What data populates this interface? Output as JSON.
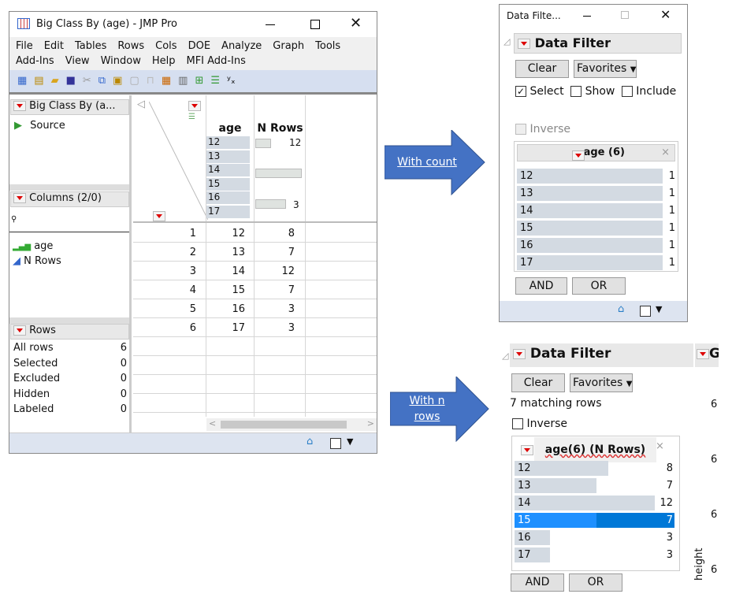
{
  "main_window": {
    "title": "Big Class By (age) - JMP Pro",
    "menu_row1": [
      "File",
      "Edit",
      "Tables",
      "Rows",
      "Cols",
      "DOE",
      "Analyze",
      "Graph",
      "Tools"
    ],
    "menu_row2": [
      "Add-Ins",
      "View",
      "Window",
      "Help",
      "MFI Add-Ins"
    ],
    "table_panel_title": "Big Class By (a...",
    "source_label": "Source",
    "columns_title": "Columns (2/0)",
    "columns": [
      "age",
      "N Rows"
    ],
    "rows_title": "Rows",
    "rows_stats": [
      {
        "label": "All rows",
        "value": "6"
      },
      {
        "label": "Selected",
        "value": "0"
      },
      {
        "label": "Excluded",
        "value": "0"
      },
      {
        "label": "Hidden",
        "value": "0"
      },
      {
        "label": "Labeled",
        "value": "0"
      }
    ],
    "headers": [
      "age",
      "N Rows"
    ],
    "hist_age": [
      "12",
      "13",
      "14",
      "15",
      "16",
      "17"
    ],
    "hist_nrows_max": "12",
    "hist_nrows_min": "3",
    "data_rows": [
      [
        "1",
        "12",
        "8"
      ],
      [
        "2",
        "13",
        "7"
      ],
      [
        "3",
        "14",
        "12"
      ],
      [
        "4",
        "15",
        "7"
      ],
      [
        "5",
        "16",
        "3"
      ],
      [
        "6",
        "17",
        "3"
      ]
    ]
  },
  "arrows": {
    "count": "With count",
    "nrows": "With n rows"
  },
  "filter_count": {
    "title": "Data Filte...",
    "heading": "Data Filter",
    "clear": "Clear",
    "favorites": "Favorites",
    "select": "Select",
    "show": "Show",
    "include": "Include",
    "select_checked": true,
    "inverse": "Inverse",
    "column_title": "age (6)",
    "levels": [
      {
        "label": "12",
        "count": "1"
      },
      {
        "label": "13",
        "count": "1"
      },
      {
        "label": "14",
        "count": "1"
      },
      {
        "label": "15",
        "count": "1"
      },
      {
        "label": "16",
        "count": "1"
      },
      {
        "label": "17",
        "count": "1"
      }
    ],
    "and": "AND",
    "or": "OR"
  },
  "filter_nrows": {
    "heading": "Data Filter",
    "clear": "Clear",
    "favorites": "Favorites",
    "matching": "7 matching rows",
    "inverse": "Inverse",
    "column_title": "age(6) (N Rows)",
    "levels": [
      {
        "label": "12",
        "count": "8",
        "value": 8
      },
      {
        "label": "13",
        "count": "7",
        "value": 7
      },
      {
        "label": "14",
        "count": "12",
        "value": 12
      },
      {
        "label": "15",
        "count": "7",
        "value": 7,
        "selected": true
      },
      {
        "label": "16",
        "count": "3",
        "value": 3
      },
      {
        "label": "17",
        "count": "3",
        "value": 3
      }
    ],
    "and": "AND",
    "or": "OR",
    "side_heading": "G",
    "side_values": [
      "6",
      "6",
      "6",
      "6"
    ],
    "axis_label": "height"
  },
  "colors": {
    "selected": "#0078d7",
    "selected_light": "#1e90ff",
    "bar": "#d3dae2",
    "arrow": "#4472c4"
  }
}
